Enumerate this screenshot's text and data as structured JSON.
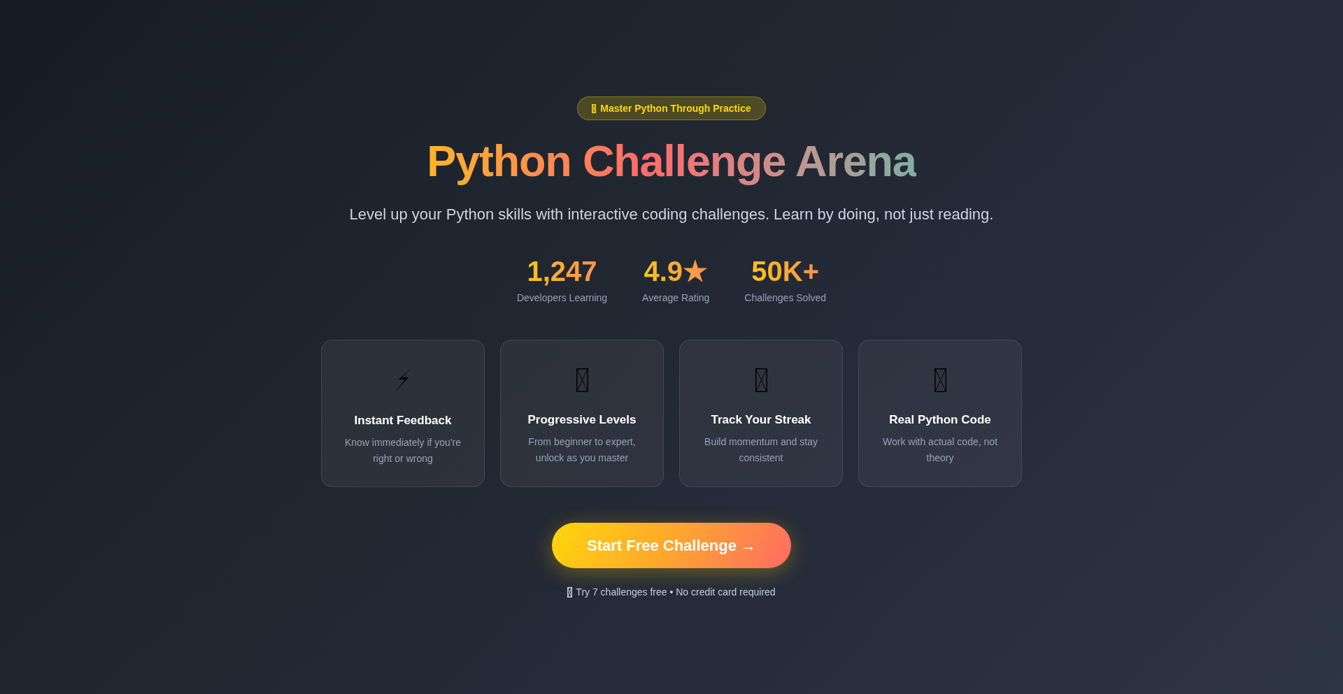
{
  "badge": {
    "text": "Master Python Through Practice"
  },
  "title": "Python Challenge Arena",
  "subtitle": "Level up your Python skills with interactive coding challenges. Learn by doing, not just reading.",
  "stats": [
    {
      "value": "1,247",
      "label": "Developers Learning"
    },
    {
      "value": "4.9★",
      "label": "Average Rating"
    },
    {
      "value": "50K+",
      "label": "Challenges Solved"
    }
  ],
  "features": [
    {
      "kind": "bolt",
      "title": "Instant Feedback",
      "description": "Know immediately if you're right or wrong"
    },
    {
      "kind": "missing",
      "title": "Progressive Levels",
      "description": "From beginner to expert, unlock as you master"
    },
    {
      "kind": "missing",
      "title": "Track Your Streak",
      "description": "Build momentum and stay consistent"
    },
    {
      "kind": "missing",
      "title": "Real Python Code",
      "description": "Work with actual code, not theory"
    }
  ],
  "cta": {
    "label": "Start Free Challenge →"
  },
  "note": "Try 7 challenges free • No credit card required"
}
